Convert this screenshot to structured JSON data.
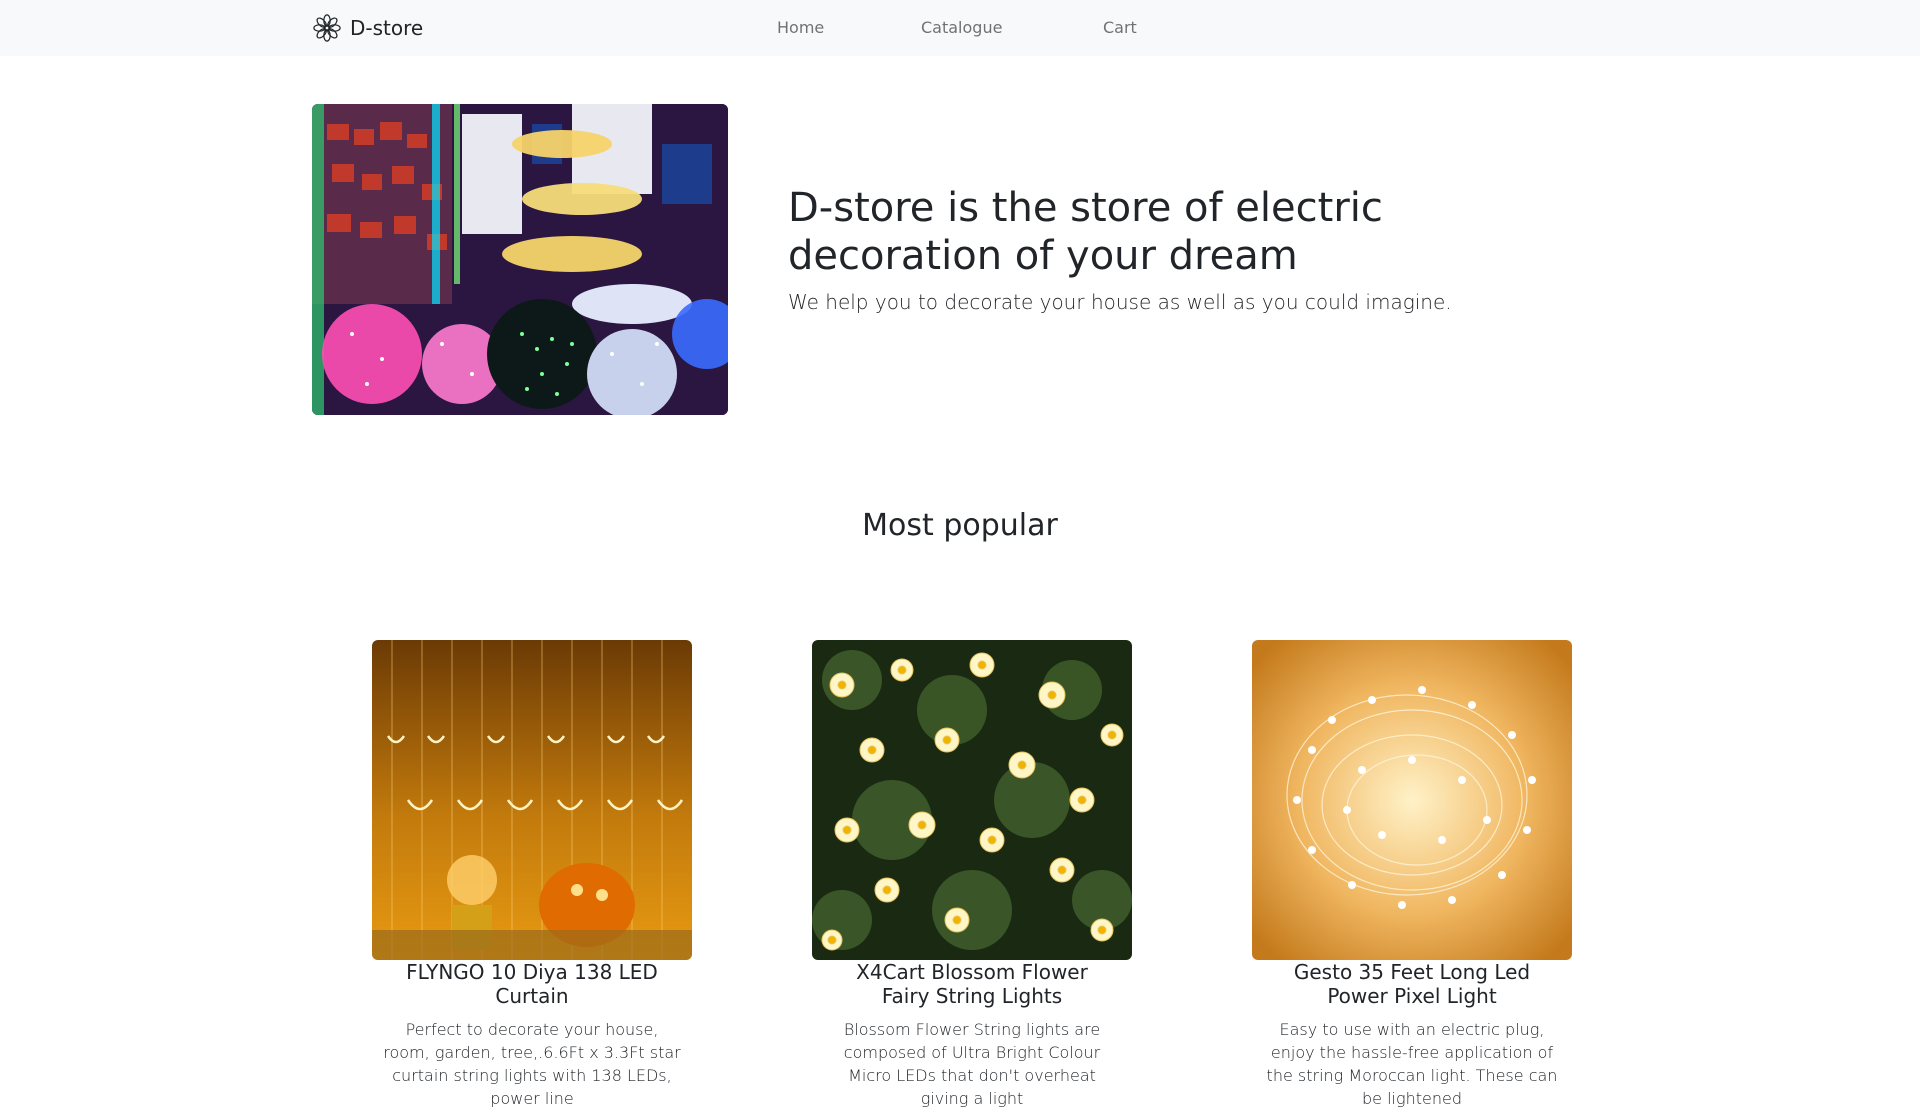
{
  "navbar": {
    "brand": "D-store",
    "links": [
      "Home",
      "Catalogue",
      "Cart"
    ]
  },
  "hero": {
    "title": "D-store is the store of electric decoration of your dream",
    "subtitle": "We help you to decorate your house as well as you could imagine."
  },
  "popular": {
    "heading": "Most popular",
    "products": [
      {
        "title": "FLYNGO 10 Diya 138 LED Curtain",
        "description": "Perfect to decorate your house, room, garden, tree,.6.6Ft x 3.3Ft star curtain string lights with 138 LEDs, power line"
      },
      {
        "title": "X4Cart Blossom Flower Fairy String Lights",
        "description": "Blossom Flower String lights are composed of Ultra Bright Colour Micro LEDs that don't overheat giving a light"
      },
      {
        "title": "Gesto 35 Feet Long Led Power Pixel Light",
        "description": "Easy to use with an electric plug, enjoy the hassle-free application of the string Moroccan light. These can be lightened"
      }
    ]
  },
  "icons": {
    "brand_logo": "mandala-flower-icon"
  },
  "colors": {
    "navbar_bg": "#f8f9fa",
    "nav_link": "#8c8c8c",
    "text": "#212529"
  }
}
